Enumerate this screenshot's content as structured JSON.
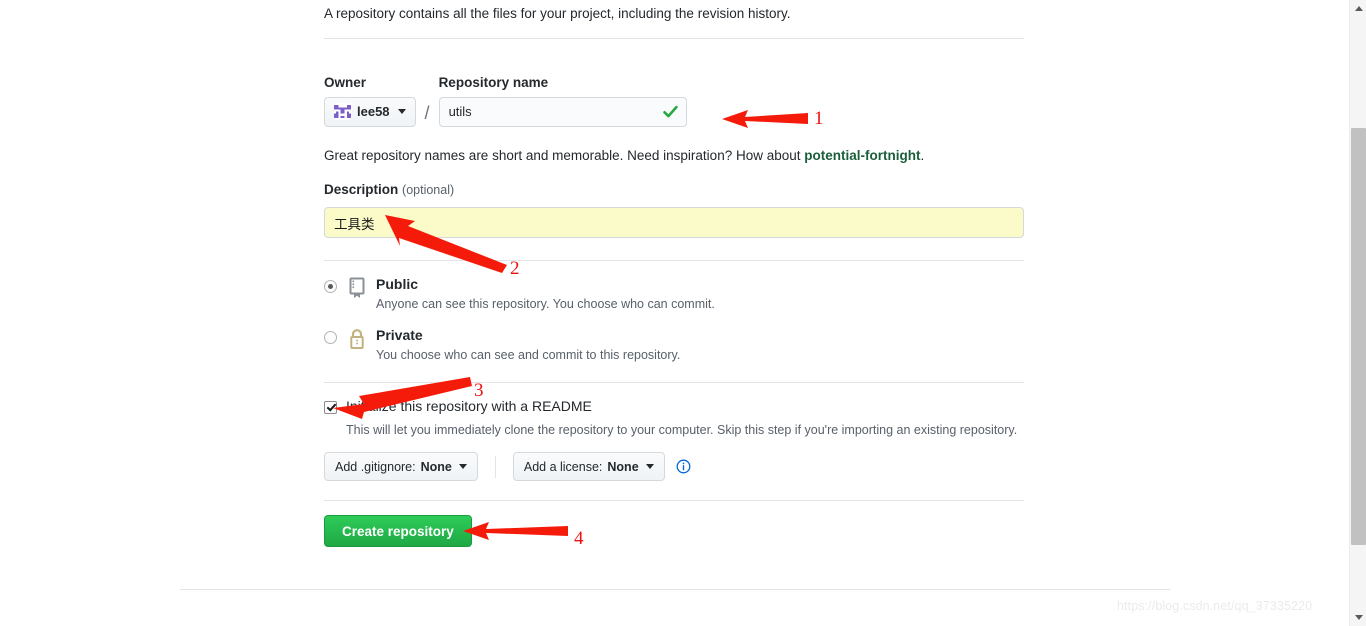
{
  "page": {
    "intro": "A repository contains all the files for your project, including the revision history."
  },
  "owner": {
    "label": "Owner",
    "name": "lee58"
  },
  "repository_name": {
    "label": "Repository name",
    "value": "utils",
    "placeholder": "",
    "validation_state": "valid"
  },
  "hint": {
    "prefix": "Great repository names are short and memorable. Need inspiration? How about ",
    "suggestion": "potential-fortnight",
    "suffix": "."
  },
  "description": {
    "label": "Description",
    "optional_label": "(optional)",
    "value": "工具类",
    "placeholder": "",
    "background_color": "#fafbc8"
  },
  "visibility": {
    "selected": "public",
    "options": [
      {
        "id": "public",
        "title": "Public",
        "description": "Anyone can see this repository. You choose who can commit.",
        "icon": "repo-icon",
        "icon_color": "#8a9096",
        "checked": true
      },
      {
        "id": "private",
        "title": "Private",
        "description": "You choose who can see and commit to this repository.",
        "icon": "lock-icon",
        "icon_color": "#c2b280",
        "checked": false
      }
    ]
  },
  "initialize": {
    "checked": true,
    "title": "Initialize this repository with a README",
    "description": "This will let you immediately clone the repository to your computer. Skip this step if you're importing an existing repository."
  },
  "gitignore": {
    "prefix": "Add .gitignore: ",
    "value": "None"
  },
  "license": {
    "prefix": "Add a license: ",
    "value": "None"
  },
  "info_icon": {
    "name": "info-icon",
    "color": "#0366d6"
  },
  "submit": {
    "label": "Create repository",
    "color": "#2ecc58"
  },
  "annotations": {
    "color": "#ee1111",
    "markers": [
      {
        "number": "1",
        "target": "repository-name-input"
      },
      {
        "number": "2",
        "target": "description-input"
      },
      {
        "number": "3",
        "target": "initialize-readme-checkbox"
      },
      {
        "number": "4",
        "target": "create-repository-button"
      }
    ]
  },
  "watermark": {
    "text": "https://blog.csdn.net/qq_37335220"
  },
  "scrollbar": {
    "up_icon": "scroll-up-arrow-icon",
    "down_icon": "scroll-down-arrow-icon"
  }
}
